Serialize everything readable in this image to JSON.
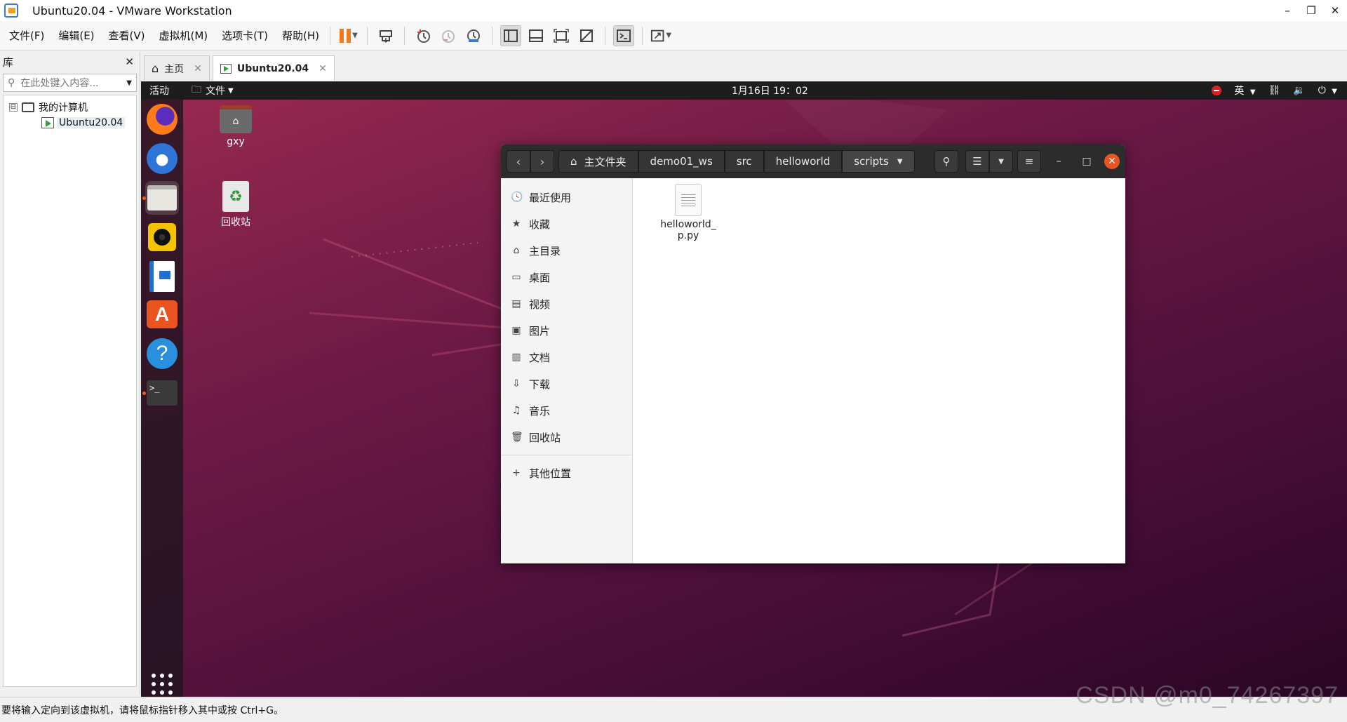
{
  "window": {
    "title": "Ubuntu20.04 - VMware Workstation",
    "minimize": "–",
    "restore": "❐",
    "close": "✕"
  },
  "menu": {
    "items": [
      "文件(F)",
      "编辑(E)",
      "查看(V)",
      "虚拟机(M)",
      "选项卡(T)",
      "帮助(H)"
    ],
    "toolbar_icons": [
      "pause-icon",
      "send-keys-icon",
      "snapshot-icon",
      "revert-snapshot-icon",
      "snapshot-manager-icon",
      "library-view-icon",
      "thumbnail-bar-icon",
      "fullscreen-icon",
      "unity-icon",
      "console-icon",
      "autofit-icon"
    ]
  },
  "library": {
    "title": "库",
    "close": "✕",
    "search_placeholder": "在此处键入内容...",
    "tree": {
      "root_expander": "⊟",
      "root": "我的计算机",
      "vm": "Ubuntu20.04"
    }
  },
  "tabs": [
    {
      "label": "主页",
      "close": "✕"
    },
    {
      "label": "Ubuntu20.04",
      "close": "✕"
    }
  ],
  "guest": {
    "topbar": {
      "activities": "活动",
      "files_menu": "文件",
      "clock": "1月16日 19：02",
      "input_method": "英"
    },
    "desktop": {
      "home_label": "gxy",
      "trash_label": "回收站"
    },
    "nautilus": {
      "breadcrumbs": [
        "主文件夹",
        "demo01_ws",
        "src",
        "helloworld",
        "scripts"
      ],
      "sidebar": [
        {
          "icon": "🕓",
          "label": "最近使用"
        },
        {
          "icon": "★",
          "label": "收藏"
        },
        {
          "icon": "⌂",
          "label": "主目录"
        },
        {
          "icon": "▭",
          "label": "桌面"
        },
        {
          "icon": "▤",
          "label": "视频"
        },
        {
          "icon": "▣",
          "label": "图片"
        },
        {
          "icon": "▥",
          "label": "文档"
        },
        {
          "icon": "⇩",
          "label": "下载"
        },
        {
          "icon": "♫",
          "label": "音乐"
        },
        {
          "icon": "🗑",
          "label": "回收站"
        }
      ],
      "other_locations": {
        "icon": "+",
        "label": "其他位置"
      },
      "files": [
        {
          "name": "helloworld_p.py",
          "line1": "helloworld_",
          "line2": "p.py"
        }
      ]
    }
  },
  "statusbar": {
    "text": "要将输入定向到该虚拟机，请将鼠标指针移入其中或按 Ctrl+G。"
  },
  "watermark": "CSDN @m0_74267397",
  "colors": {
    "ubuntu_orange": "#e95420",
    "pause_orange": "#f07a18",
    "guest_bg": "#6d1a45"
  }
}
